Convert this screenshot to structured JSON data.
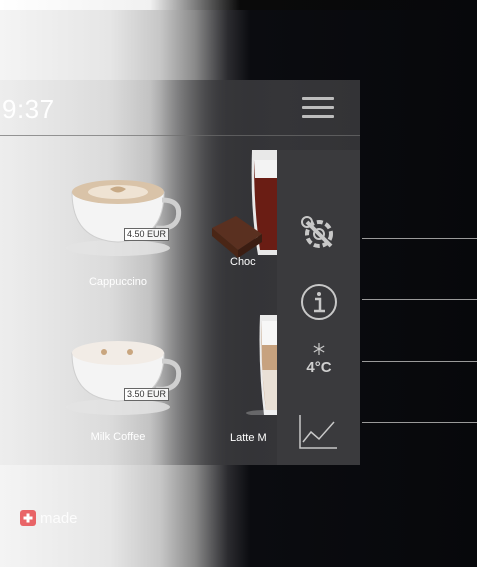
{
  "header": {
    "time": "9:37"
  },
  "drinks": [
    {
      "name": "Cappuccino",
      "price": "4.50 EUR"
    },
    {
      "name": "Choc",
      "price": ""
    },
    {
      "name": "Milk Coffee",
      "price": "3.50 EUR"
    },
    {
      "name": "Latte M",
      "price": ""
    }
  ],
  "side_menu": {
    "items": [
      {
        "icon": "settings-wrench-gear-icon"
      },
      {
        "icon": "info-icon"
      },
      {
        "icon": "snowflake-icon",
        "temperature": "4°C"
      },
      {
        "icon": "statistics-chart-icon"
      }
    ]
  },
  "footer": {
    "brand_text": "made",
    "brand_icon": "swiss-cross-icon"
  },
  "colors": {
    "panel": "#3a3a3d",
    "screen_text": "#ffffff",
    "icon": "#c8c8c8",
    "background": "#07080b"
  }
}
